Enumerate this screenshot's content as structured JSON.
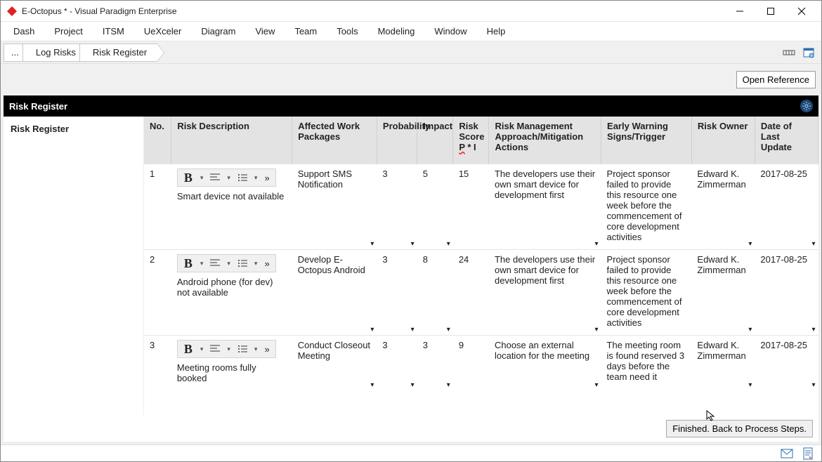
{
  "titlebar": {
    "title": "E-Octopus * - Visual Paradigm Enterprise"
  },
  "menubar": {
    "items": [
      "Dash",
      "Project",
      "ITSM",
      "UeXceler",
      "Diagram",
      "View",
      "Team",
      "Tools",
      "Modeling",
      "Window",
      "Help"
    ]
  },
  "breadcrumb": {
    "items": [
      "...",
      "Log Risks",
      "Risk Register"
    ]
  },
  "buttons": {
    "open_reference": "Open Reference",
    "finished": "Finished. Back to Process Steps."
  },
  "panel": {
    "title": "Risk Register",
    "side_label": "Risk Register"
  },
  "table": {
    "headers": {
      "no": "No.",
      "desc": "Risk Description",
      "awp": "Affected Work Packages",
      "prob": "Probability",
      "impact": "Impact",
      "score": "Risk Score P * I",
      "approach": "Risk Management Approach/Mitigation Actions",
      "warning": "Early Warning Signs/Trigger",
      "owner": "Risk Owner",
      "date": "Date of Last Update"
    },
    "rows": [
      {
        "no": "1",
        "desc": "Smart device not available",
        "awp": "Support SMS Notification",
        "prob": "3",
        "impact": "5",
        "score": "15",
        "approach": "The developers use their own smart device for development first",
        "warning": "Project sponsor failed to provide this resource one week before the commencement of core development activities",
        "owner": "Edward K. Zimmerman",
        "date": "2017-08-25"
      },
      {
        "no": "2",
        "desc": "Android phone (for dev) not available",
        "awp": "Develop E-Octopus Android",
        "prob": "3",
        "impact": "8",
        "score": "24",
        "approach": "The developers use their own smart device for development first",
        "warning": "Project sponsor failed to provide this resource one week before the commencement of core development activities",
        "owner": "Edward K. Zimmerman",
        "date": "2017-08-25"
      },
      {
        "no": "3",
        "desc": "Meeting rooms fully booked",
        "awp": "Conduct Closeout Meeting",
        "prob": "3",
        "impact": "3",
        "score": "9",
        "approach": "Choose an external location for the meeting",
        "warning": "The meeting room is found reserved 3 days before the team need it",
        "owner": "Edward K. Zimmerman",
        "date": "2017-08-25"
      }
    ]
  }
}
